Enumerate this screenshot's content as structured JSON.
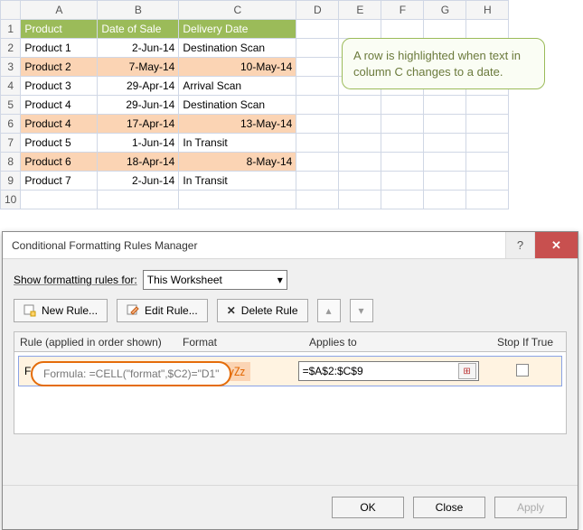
{
  "callout": "A row is highlighted when text in column C changes to a date.",
  "columns": [
    "A",
    "B",
    "C",
    "D",
    "E",
    "F",
    "G",
    "H"
  ],
  "header": {
    "A": "Product",
    "B": "Date of Sale",
    "C": "Delivery Date"
  },
  "rows": [
    {
      "n": 1
    },
    {
      "n": 2,
      "A": "Product 1",
      "B": "2-Jun-14",
      "C": "Destination Scan",
      "hl": false
    },
    {
      "n": 3,
      "A": "Product 2",
      "B": "7-May-14",
      "C": "10-May-14",
      "hl": true,
      "cnum": true
    },
    {
      "n": 4,
      "A": "Product 3",
      "B": "29-Apr-14",
      "C": "Arrival Scan",
      "hl": false
    },
    {
      "n": 5,
      "A": "Product 4",
      "B": "29-Jun-14",
      "C": "Destination Scan",
      "hl": false
    },
    {
      "n": 6,
      "A": "Product 4",
      "B": "17-Apr-14",
      "C": "13-May-14",
      "hl": true,
      "cnum": true
    },
    {
      "n": 7,
      "A": "Product 5",
      "B": "1-Jun-14",
      "C": "In Transit",
      "hl": false
    },
    {
      "n": 8,
      "A": "Product 6",
      "B": "18-Apr-14",
      "C": "8-May-14",
      "hl": true,
      "cnum": true
    },
    {
      "n": 9,
      "A": "Product 7",
      "B": "2-Jun-14",
      "C": "In Transit",
      "hl": false
    },
    {
      "n": 10
    }
  ],
  "dialog": {
    "title": "Conditional Formatting Rules Manager",
    "showFor_label": "Show formatting rules for:",
    "showFor_value": "This Worksheet",
    "btn_new": "New Rule...",
    "btn_edit": "Edit Rule...",
    "btn_delete": "Delete Rule",
    "col_rule": "Rule (applied in order shown)",
    "col_format": "Format",
    "col_applies": "Applies to",
    "col_stop": "Stop If True",
    "rule_text": "Formula: =CELL(\"format\"...",
    "format_preview": "AaBbCcYyZz",
    "applies_to": "=$A$2:$C$9",
    "annotation": "Formula: =CELL(\"format\",$C2)=\"D1\"",
    "btn_ok": "OK",
    "btn_close": "Close",
    "btn_apply": "Apply"
  }
}
